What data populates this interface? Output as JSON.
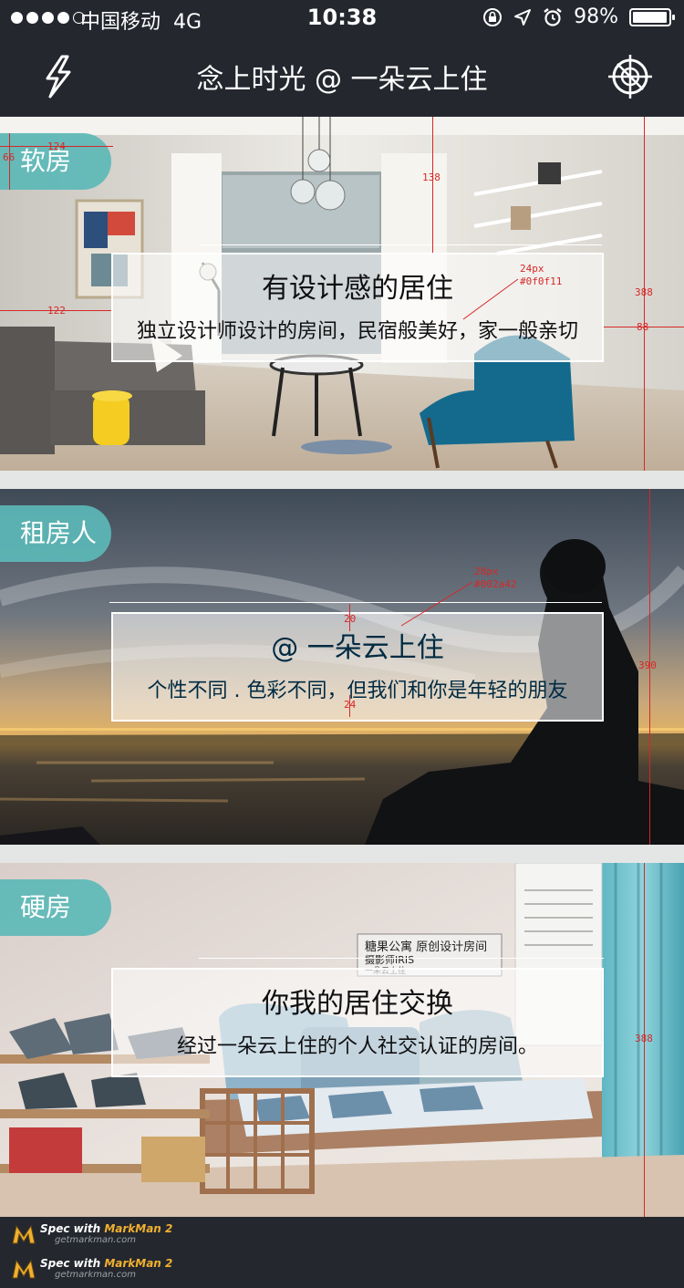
{
  "status_bar": {
    "carrier": "中国移动",
    "network": "4G",
    "time": "10:38",
    "battery": "98%",
    "battery_level": 0.98
  },
  "nav": {
    "title": "念上时光 @ 一朵云上住",
    "left_icon": "lightning-icon",
    "right_icon": "crosshair-icon"
  },
  "cards": [
    {
      "tag": "软房",
      "title": "有设计感的居住",
      "subtitle": "独立设计师设计的房间，民宿般美好，家一般亲切"
    },
    {
      "tag": "租房人",
      "title": "@ 一朵云上住",
      "subtitle": "个性不同 . 色彩不同，但我们和你是年轻的朋友"
    },
    {
      "tag": "硬房",
      "title": "你我的居住交换",
      "subtitle": "经过一朵云上住的个人社交认证的房间。",
      "sign": {
        "line1": "糖果公寓 原创设计房间",
        "line2": "摄影师IRIS",
        "line3": "一朵云上住"
      }
    }
  ],
  "spec_annotations": {
    "card1": [
      "124",
      "66",
      "138",
      "122",
      "388",
      "88",
      "24px",
      "#0f0f11"
    ],
    "card2": [
      "28px",
      "#002a42",
      "20",
      "24",
      "390"
    ],
    "card3": [
      "388"
    ]
  },
  "footer": {
    "watermarks": [
      {
        "spec": "Spec with",
        "brand": "MarkMan 2",
        "url": "getmarkman.com"
      },
      {
        "spec": "Spec with",
        "brand": "MarkMan 2",
        "url": "getmarkman.com"
      }
    ]
  }
}
